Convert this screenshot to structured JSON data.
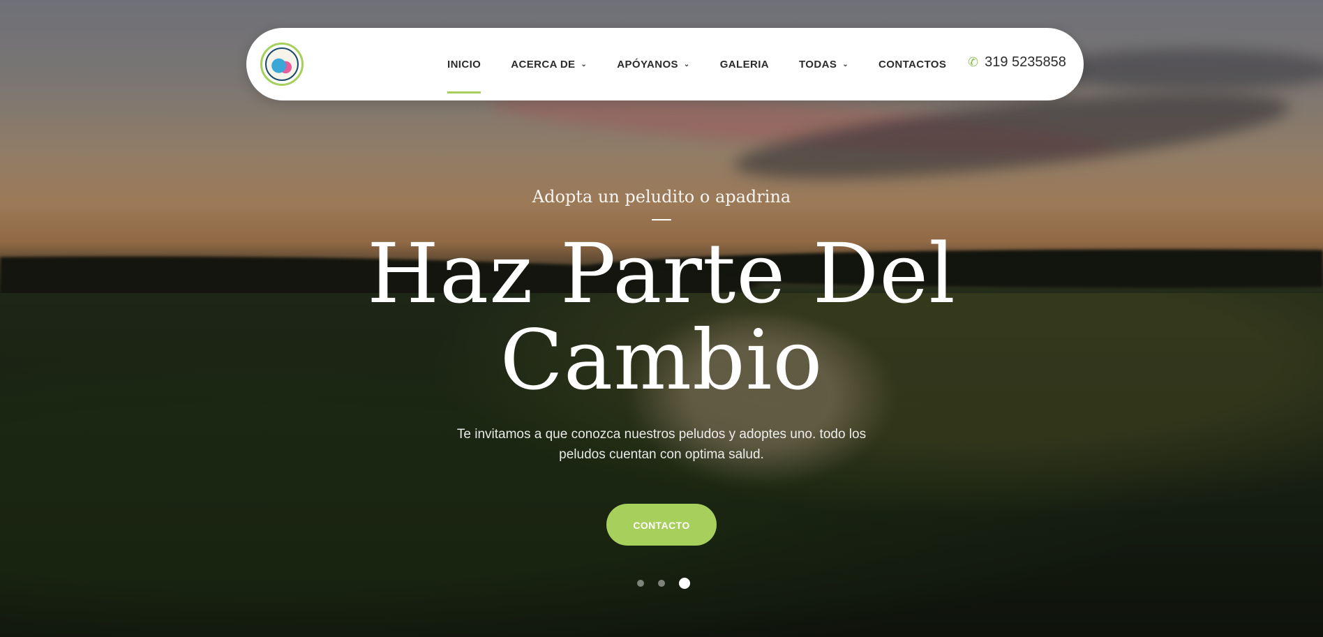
{
  "brand": {
    "logo_icon": "dog-cat-logo-icon",
    "accent_color": "#a6cf5b"
  },
  "nav": {
    "items": [
      {
        "label": "INICIO",
        "active": true,
        "dropdown": false
      },
      {
        "label": "ACERCA DE",
        "active": false,
        "dropdown": true
      },
      {
        "label": "APÓYANOS",
        "active": false,
        "dropdown": true
      },
      {
        "label": "GALERIA",
        "active": false,
        "dropdown": false
      },
      {
        "label": "TODAS",
        "active": false,
        "dropdown": true
      },
      {
        "label": "CONTACTOS",
        "active": false,
        "dropdown": false
      }
    ],
    "phone": "319 5235858",
    "phone_icon": "phone-icon"
  },
  "hero": {
    "eyebrow": "Adopta un peludito o apadrina",
    "headline_line1": "Haz Parte Del",
    "headline_line2": "Cambio",
    "subtitle": "Te invitamos a que conozca nuestros peludos y adoptes uno. todo los peludos cuentan con optima salud.",
    "cta_label": "CONTACTO"
  },
  "slider": {
    "total_slides": 3,
    "active_slide": 3
  }
}
